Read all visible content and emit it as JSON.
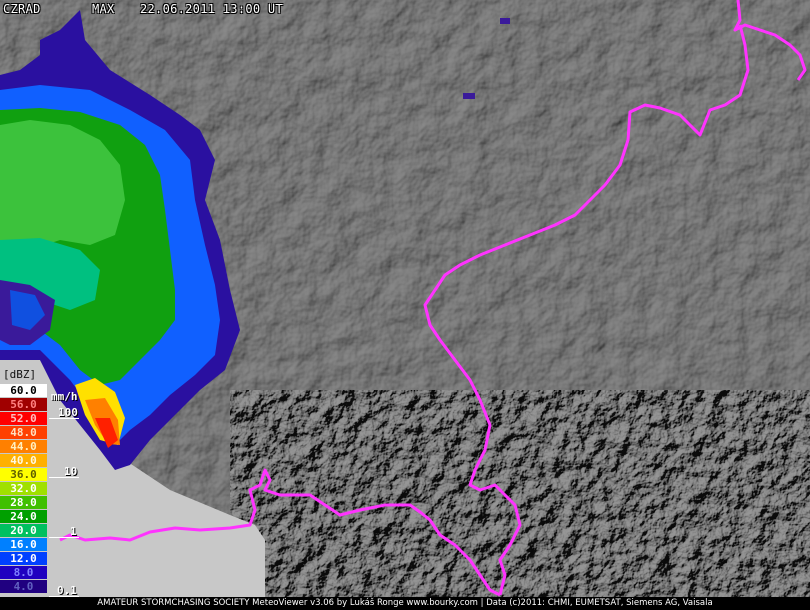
{
  "header": {
    "source": "CZRAD",
    "product": "MAX",
    "datetime": "22.06.2011 13:00 UT"
  },
  "legend": {
    "units_label": "[dBZ]",
    "rate_units": "mm/h",
    "rate_labels": [
      "100",
      "10",
      "1",
      "0.1"
    ],
    "entries": [
      {
        "value": "60.0",
        "color": "#ffffff",
        "text_color": "#000000"
      },
      {
        "value": "56.0",
        "color": "#a00000",
        "text_color": "#ff8080"
      },
      {
        "value": "52.0",
        "color": "#ff0000",
        "text_color": "#ffc0c0"
      },
      {
        "value": "48.0",
        "color": "#ff4000",
        "text_color": "#ffe0c0"
      },
      {
        "value": "44.0",
        "color": "#ff8000",
        "text_color": "#fff0c0"
      },
      {
        "value": "40.0",
        "color": "#ffb000",
        "text_color": "#fff8e0"
      },
      {
        "value": "36.0",
        "color": "#ffff00",
        "text_color": "#606000"
      },
      {
        "value": "32.0",
        "color": "#a0e000",
        "text_color": "#ffffff"
      },
      {
        "value": "28.0",
        "color": "#40c000",
        "text_color": "#ffffff"
      },
      {
        "value": "24.0",
        "color": "#00a000",
        "text_color": "#ffffff"
      },
      {
        "value": "20.0",
        "color": "#00c060",
        "text_color": "#ffffff"
      },
      {
        "value": "16.0",
        "color": "#0080ff",
        "text_color": "#ffffff"
      },
      {
        "value": "12.0",
        "color": "#0040ff",
        "text_color": "#ffffff"
      },
      {
        "value": "8.0",
        "color": "#2000c0",
        "text_color": "#8080ff"
      },
      {
        "value": "4.0",
        "color": "#200080",
        "text_color": "#6060c0"
      }
    ]
  },
  "colors": {
    "border": "#ff33ff",
    "no_data": "#c8c8c8",
    "terrain": "#6e6e6e"
  },
  "footer": {
    "text": "AMATEUR STORMCHASING SOCIETY MeteoViewer v3.06 by Lukáš Ronge www.bourky.com | Data (c)2011: CHMI, EUMETSAT, Siemens AG, Vaisala"
  }
}
